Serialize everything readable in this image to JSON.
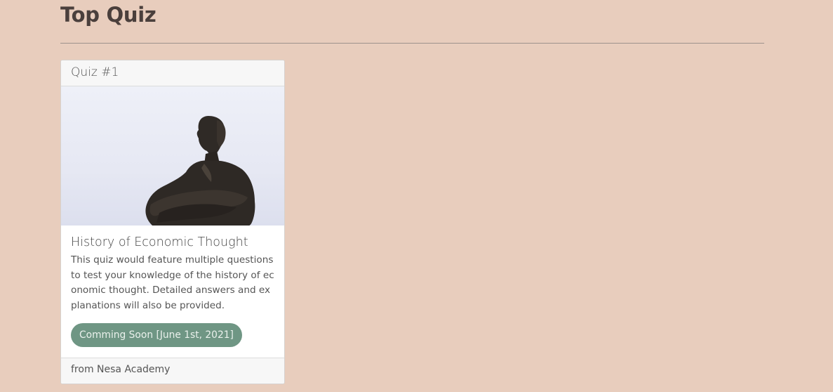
{
  "page": {
    "title": "Top Quiz"
  },
  "quiz_card": {
    "header": "Quiz #1",
    "image_icon": "statue-image",
    "title": "History of Economic Thought",
    "description": "This quiz would feature multiple questions to test your knowledge of the history of economic thought. Detailed answers and explanations will also be provided.",
    "status_label": "Comming Soon [June 1st, 2021]",
    "status_color": "#6f9684",
    "footer": "from Nesa Academy"
  },
  "colors": {
    "background": "#e8cdbd",
    "title": "#4a3f3c"
  }
}
